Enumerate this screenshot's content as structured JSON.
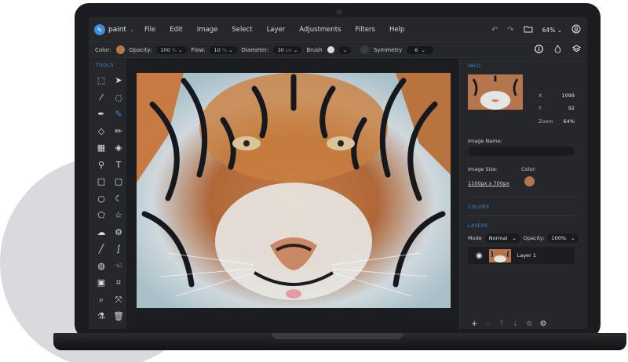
{
  "app": {
    "logo_text": "paint"
  },
  "menu": [
    "File",
    "Edit",
    "Image",
    "Select",
    "Layer",
    "Adjustments",
    "Filters",
    "Help"
  ],
  "topbar": {
    "zoom": "64%"
  },
  "options": {
    "color_label": "Color:",
    "opacity_label": "Opacity:",
    "opacity_value": "100",
    "flow_label": "Flow:",
    "flow_value": "10",
    "diameter_label": "Diameter:",
    "diameter_value": "30",
    "brush_label": "Brush",
    "symmetry_label": "Symmetry",
    "symmetry_value": "6",
    "unit": "%",
    "unit_px": "px"
  },
  "tools": {
    "title": "TOOLS"
  },
  "info": {
    "title": "INFO",
    "x_label": "X",
    "x_value": "1099",
    "y_label": "Y",
    "y_value": "92",
    "zoom_label": "Zoom",
    "zoom_value": "64%",
    "image_name_label": "Image Name:",
    "image_size_label": "Image Size:",
    "image_size_value": "1100px x 700px",
    "color_label": "Color:"
  },
  "colors": {
    "title": "COLORS"
  },
  "layers": {
    "title": "LAYERS",
    "mode_label": "Mode",
    "mode_value": "Normal",
    "opacity_label": "Opacity:",
    "opacity_value": "100%",
    "layer_name": "Layer 1"
  },
  "palette": {
    "accent": "#3b8ed9",
    "selected_color": "#b5764e"
  }
}
